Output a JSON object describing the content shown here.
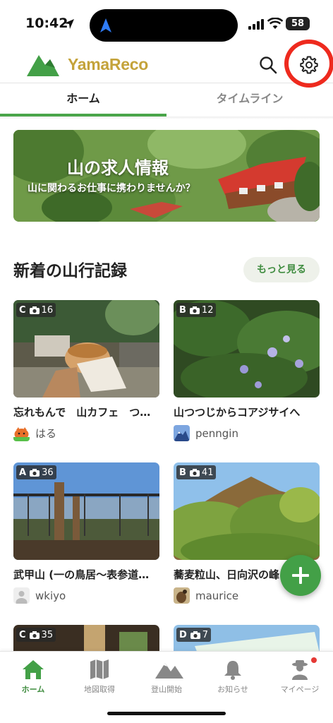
{
  "status_bar": {
    "time": "10:42",
    "battery": "58"
  },
  "header": {
    "brand": "YamaReco"
  },
  "tabs": [
    {
      "label": "ホーム"
    },
    {
      "label": "タイムライン"
    }
  ],
  "banner": {
    "title": "山の求人情報",
    "subtitle": "山に関わるお仕事に携わりませんか？"
  },
  "section": {
    "title": "新着の山行記録",
    "more_label": "もっと見る"
  },
  "records": [
    {
      "grade": "C",
      "photos": "16",
      "title": "忘れもんで　山カフェ　つ…",
      "user": "はる"
    },
    {
      "grade": "B",
      "photos": "12",
      "title": "山つつじからコアジサイへ",
      "user": "penngin"
    },
    {
      "grade": "A",
      "photos": "36",
      "title": "武甲山 (一の鳥居〜表参道…",
      "user": "wkiyo"
    },
    {
      "grade": "B",
      "photos": "41",
      "title": "蕎麦粒山、日向沢の峰",
      "user": "maurice"
    },
    {
      "grade": "C",
      "photos": "35"
    },
    {
      "grade": "D",
      "photos": "7"
    }
  ],
  "bottom_nav": [
    {
      "label": "ホーム"
    },
    {
      "label": "地図取得"
    },
    {
      "label": "登山開始"
    },
    {
      "label": "お知らせ"
    },
    {
      "label": "マイページ"
    }
  ],
  "colors": {
    "brand_green": "#43a047",
    "brand_gold": "#c4a33b",
    "highlight_red": "#ee2a1e",
    "notification_dot": "#e53935"
  }
}
